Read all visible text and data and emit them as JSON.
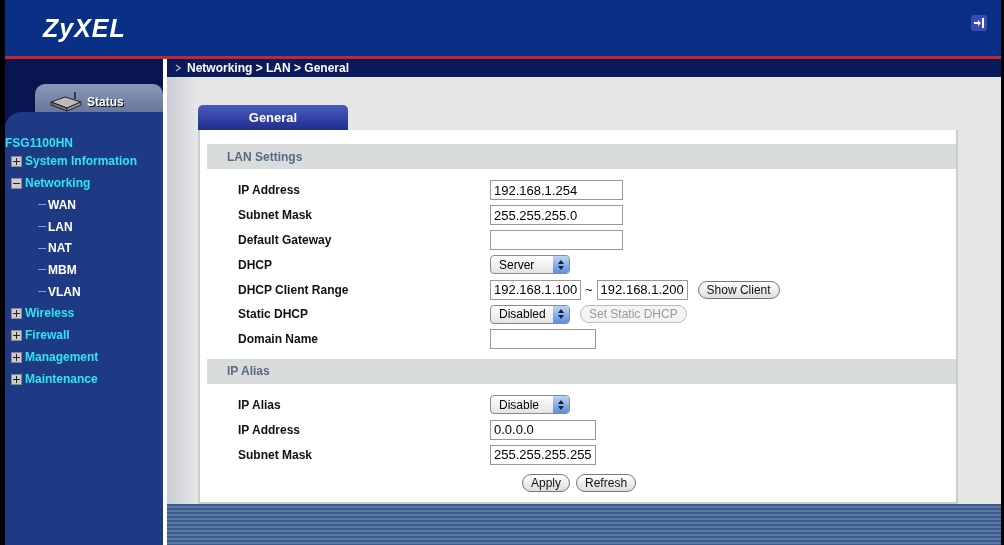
{
  "header": {
    "logo": "ZyXEL"
  },
  "sidebar": {
    "tab": "Status",
    "root": "FSG1100HN",
    "items": [
      {
        "label": "System Information",
        "expanded": false
      },
      {
        "label": "Networking",
        "expanded": true,
        "children": [
          {
            "label": "WAN"
          },
          {
            "label": "LAN"
          },
          {
            "label": "NAT"
          },
          {
            "label": "MBM"
          },
          {
            "label": "VLAN"
          }
        ]
      },
      {
        "label": "Wireless",
        "expanded": false
      },
      {
        "label": "Firewall",
        "expanded": false
      },
      {
        "label": "Management",
        "expanded": false
      },
      {
        "label": "Maintenance",
        "expanded": false
      }
    ]
  },
  "breadcrumb": "Networking > LAN > General",
  "tabs": [
    {
      "label": "General",
      "selected": true
    }
  ],
  "sections": [
    {
      "title": "LAN Settings",
      "rows": [
        {
          "kind": "text",
          "label": "IP Address",
          "value": "192.168.1.254",
          "wide": true
        },
        {
          "kind": "text",
          "label": "Subnet Mask",
          "value": "255.255.255.0",
          "wide": true
        },
        {
          "kind": "text",
          "label": "Default Gateway",
          "value": "",
          "wide": true
        },
        {
          "kind": "select",
          "label": "DHCP",
          "value": "Server"
        },
        {
          "kind": "range",
          "label": "DHCP Client Range",
          "from": "192.168.1.100",
          "sep": "~",
          "to": "192.168.1.200",
          "button": {
            "label": "Show Client",
            "disabled": false
          }
        },
        {
          "kind": "select",
          "label": "Static DHCP",
          "value": "Disabled",
          "button": {
            "label": "Set Static DHCP",
            "disabled": true
          }
        },
        {
          "kind": "text",
          "label": "Domain Name",
          "value": "",
          "wide": false
        }
      ]
    },
    {
      "title": "IP Alias",
      "rows": [
        {
          "kind": "select",
          "label": "IP Alias",
          "value": "Disable"
        },
        {
          "kind": "text",
          "label": "IP Address",
          "value": "0.0.0.0",
          "wide": false
        },
        {
          "kind": "text",
          "label": "Subnet Mask",
          "value": "255.255.255.255",
          "wide": false
        }
      ]
    }
  ],
  "buttons": [
    "Apply",
    "Refresh"
  ]
}
